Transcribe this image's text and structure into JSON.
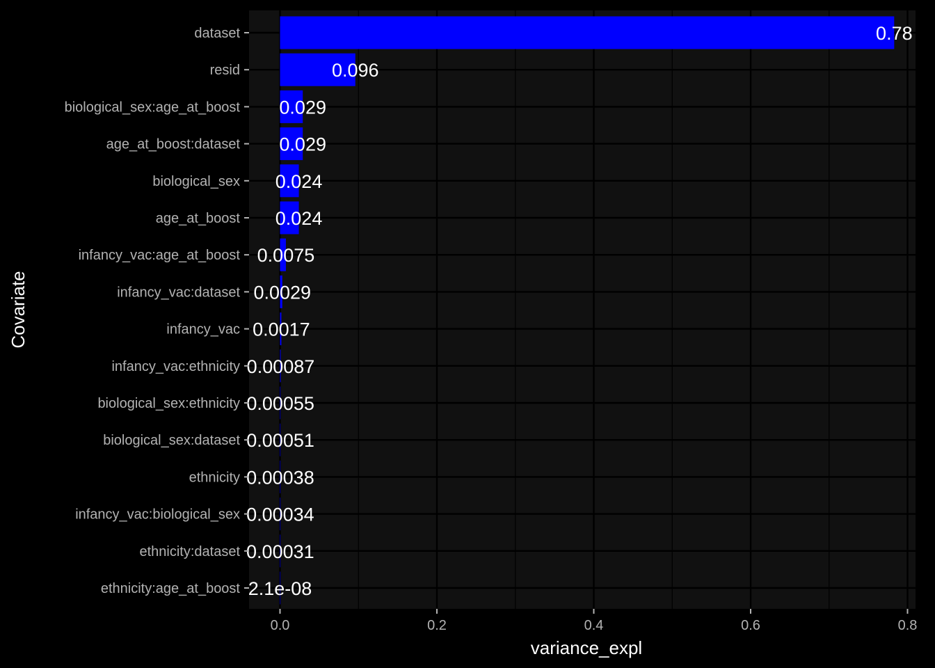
{
  "colors": {
    "background": "#000000",
    "panel": "#111111",
    "grid": "#000000",
    "bar": "#0000ff",
    "label": "#ffffff",
    "tick_text": "#b3b3b3"
  },
  "chart_data": {
    "type": "bar",
    "orientation": "horizontal",
    "title": "",
    "xlabel": "variance_expl",
    "ylabel": "Covariate",
    "xlim": [
      -0.039,
      0.82
    ],
    "x_ticks": [
      0.0,
      0.2,
      0.4,
      0.6,
      0.8
    ],
    "x_tick_labels": [
      "0.0",
      "0.2",
      "0.4",
      "0.6",
      "0.8"
    ],
    "grid": true,
    "legend": "none",
    "categories": [
      "dataset",
      "resid",
      "biological_sex:age_at_boost",
      "age_at_boost:dataset",
      "biological_sex",
      "age_at_boost",
      "infancy_vac:age_at_boost",
      "infancy_vac:dataset",
      "infancy_vac",
      "infancy_vac:ethnicity",
      "biological_sex:ethnicity",
      "biological_sex:dataset",
      "ethnicity",
      "infancy_vac:biological_sex",
      "ethnicity:dataset",
      "ethnicity:age_at_boost"
    ],
    "values": [
      0.783,
      0.096,
      0.029,
      0.029,
      0.024,
      0.024,
      0.0075,
      0.0029,
      0.0017,
      0.00087,
      0.00055,
      0.00051,
      0.00038,
      0.00034,
      0.00031,
      2.1e-08
    ],
    "data_labels": [
      "0.78",
      "0.096",
      "0.029",
      "0.029",
      "0.024",
      "0.024",
      "0.0075",
      "0.0029",
      "0.0017",
      "0.00087",
      "0.00055",
      "0.00051",
      "0.00038",
      "0.00034",
      "0.00031",
      "2.1e-08"
    ]
  }
}
